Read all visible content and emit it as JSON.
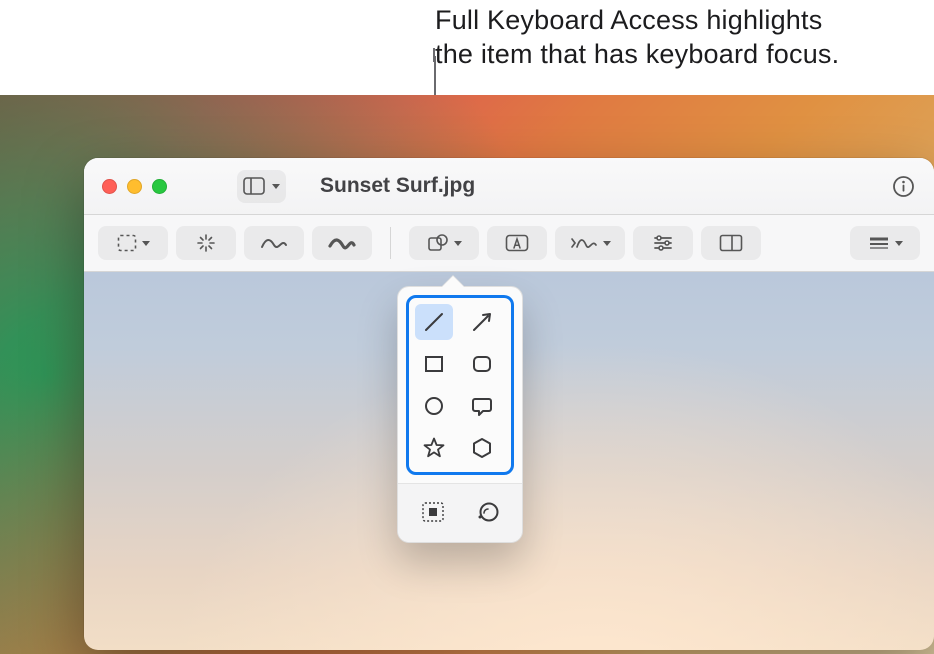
{
  "caption": {
    "line1": "Full Keyboard Access highlights",
    "line2": "the item that has keyboard focus."
  },
  "colors": {
    "focus": "#1079ee"
  },
  "window": {
    "title": "Sunset Surf.jpg",
    "traffic": [
      "close",
      "minimize",
      "zoom"
    ],
    "sidebar_button_label": "Sidebar",
    "info_button_label": "Inspector"
  },
  "toolbar": {
    "items": [
      {
        "name": "selection-tool",
        "label": "Rectangular Selection",
        "has_menu": true
      },
      {
        "name": "instant-alpha",
        "label": "Instant Alpha",
        "has_menu": false
      },
      {
        "name": "sketch-tool",
        "label": "Sketch",
        "has_menu": false
      },
      {
        "name": "draw-tool",
        "label": "Draw",
        "has_menu": false
      },
      {
        "name": "shapes-tool",
        "label": "Shapes",
        "has_menu": true
      },
      {
        "name": "text-tool",
        "label": "Text",
        "has_menu": false
      },
      {
        "name": "sign-tool",
        "label": "Sign",
        "has_menu": true
      },
      {
        "name": "adjust-color",
        "label": "Adjust Color",
        "has_menu": false
      },
      {
        "name": "adjust-size",
        "label": "Adjust Size",
        "has_menu": false
      },
      {
        "name": "shape-style",
        "label": "Shape Style",
        "has_menu": true
      }
    ]
  },
  "shapes_popover": {
    "focused_group": "shape-grid",
    "selected_shape": "line",
    "shapes": [
      {
        "name": "line",
        "label": "Line"
      },
      {
        "name": "arrow",
        "label": "Arrow"
      },
      {
        "name": "rectangle",
        "label": "Rectangle"
      },
      {
        "name": "rounded-rect",
        "label": "Rounded Rectangle"
      },
      {
        "name": "oval",
        "label": "Oval"
      },
      {
        "name": "speech-bubble",
        "label": "Speech Bubble"
      },
      {
        "name": "star",
        "label": "Star"
      },
      {
        "name": "polygon",
        "label": "Polygon"
      }
    ],
    "extras": [
      {
        "name": "mask",
        "label": "Mask"
      },
      {
        "name": "loupe",
        "label": "Loupe"
      }
    ]
  }
}
